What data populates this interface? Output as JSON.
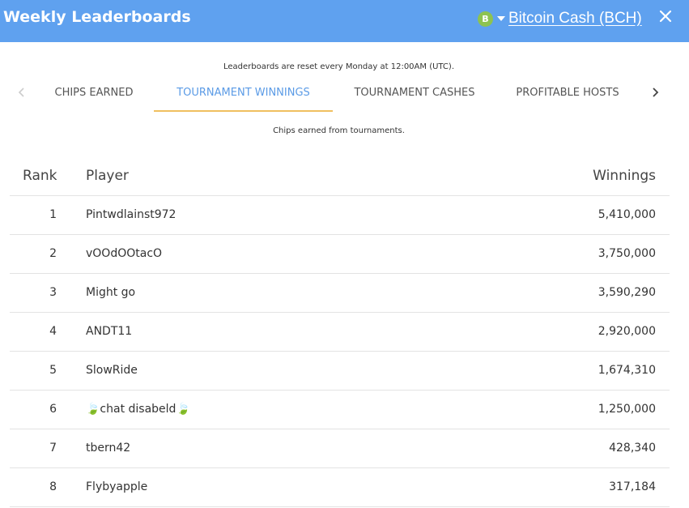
{
  "header": {
    "title": "Weekly Leaderboards",
    "currency_icon": "B",
    "currency_label": "Bitcoin Cash (BCH)",
    "accent": "#5fa1ef",
    "bch_color": "#8dc351"
  },
  "reset_note": "Leaderboards are reset every Monday at 12:00AM (UTC).",
  "tabs": [
    {
      "label": "CHIPS EARNED",
      "active": false
    },
    {
      "label": "TOURNAMENT WINNINGS",
      "active": true
    },
    {
      "label": "TOURNAMENT CASHES",
      "active": false
    },
    {
      "label": "PROFITABLE HOSTS",
      "active": false
    }
  ],
  "subtitle": "Chips earned from tournaments.",
  "table": {
    "headers": {
      "rank": "Rank",
      "player": "Player",
      "winnings": "Winnings"
    },
    "rows": [
      {
        "rank": "1",
        "player": "Pintwdlainst972",
        "winnings": "5,410,000"
      },
      {
        "rank": "2",
        "player": "vOOdOOtacO",
        "winnings": "3,750,000"
      },
      {
        "rank": "3",
        "player": "Might go",
        "winnings": "3,590,290"
      },
      {
        "rank": "4",
        "player": "ANDT11",
        "winnings": "2,920,000"
      },
      {
        "rank": "5",
        "player": "SlowRide",
        "winnings": "1,674,310"
      },
      {
        "rank": "6",
        "player": "🍃chat disabeld🍃",
        "winnings": "1,250,000"
      },
      {
        "rank": "7",
        "player": "tbern42",
        "winnings": "428,340"
      },
      {
        "rank": "8",
        "player": "Flybyapple",
        "winnings": "317,184"
      }
    ]
  }
}
